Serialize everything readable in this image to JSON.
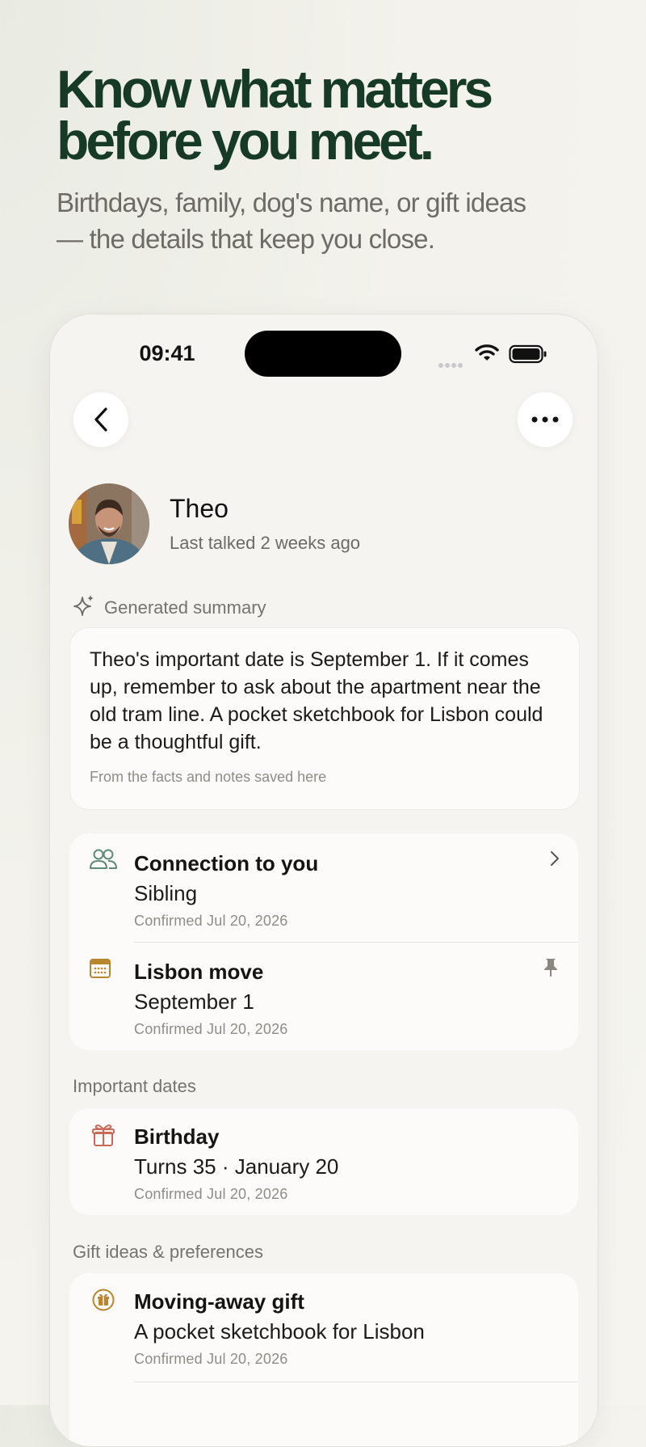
{
  "hero": {
    "title_line1": "Know what matters",
    "title_line2": "before you meet.",
    "subtitle_line1": "Birthdays, family, dog's name, or gift ideas",
    "subtitle_line2": "— the details that keep you close."
  },
  "status_bar": {
    "time": "09:41"
  },
  "contact": {
    "name": "Theo",
    "last_talked": "Last talked 2 weeks ago"
  },
  "summary": {
    "label": "Generated summary",
    "text": "Theo's important date is September 1. If it comes up, remember to ask about the apartment near the old tram line. A pocket sketchbook for Lisbon could be a thoughtful gift.",
    "footnote": "From the facts and notes saved here"
  },
  "facts": [
    {
      "icon": "people-icon",
      "title": "Connection to you",
      "value": "Sibling",
      "meta": "Confirmed Jul 20, 2026"
    },
    {
      "icon": "calendar-icon",
      "title": "Lisbon move",
      "value": "September 1",
      "meta": "Confirmed Jul 20, 2026"
    }
  ],
  "important_dates": {
    "label": "Important dates",
    "items": [
      {
        "icon": "gift-icon",
        "title": "Birthday",
        "value": "Turns 35 · January 20",
        "meta": "Confirmed Jul 20, 2026"
      }
    ]
  },
  "gifts": {
    "label": "Gift ideas & preferences",
    "items": [
      {
        "icon": "gift-badge-icon",
        "title": "Moving-away gift",
        "value": "A pocket sketchbook for Lisbon",
        "meta": "Confirmed Jul 20, 2026"
      }
    ]
  },
  "colors": {
    "brand_green": "#173a26",
    "icon_green": "#5f8a78",
    "icon_amber": "#b8862e",
    "icon_red": "#c96a58"
  }
}
